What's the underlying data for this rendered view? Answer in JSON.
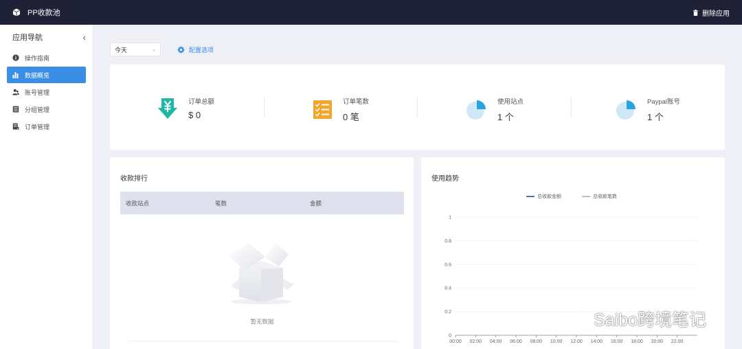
{
  "app": {
    "title": "PP收款池",
    "delete_app": "删除应用"
  },
  "sidebar": {
    "title": "应用导航",
    "collapse": "‹",
    "items": [
      {
        "label": "操作指南",
        "icon": "info-circle-icon"
      },
      {
        "label": "数据概览",
        "icon": "bar-chart-icon",
        "active": true
      },
      {
        "label": "账号管理",
        "icon": "users-icon"
      },
      {
        "label": "分组管理",
        "icon": "list-icon"
      },
      {
        "label": "订单管理",
        "icon": "order-icon"
      }
    ]
  },
  "toolbar": {
    "date_select": "今天",
    "config_link": "配置选项"
  },
  "stats": [
    {
      "label": "订单总额",
      "value": "$ 0",
      "icon": "yuan-download-icon",
      "color": "#1fb8a4"
    },
    {
      "label": "订单笔数",
      "value": "0 笔",
      "icon": "checklist-icon",
      "color": "#f4a52c"
    },
    {
      "label": "使用站点",
      "value": "1 个",
      "icon": "pie-icon",
      "color": "#2aa4dd"
    },
    {
      "label": "Paypal账号",
      "value": "1 个",
      "icon": "pie-icon",
      "color": "#2aa4dd"
    }
  ],
  "ranking": {
    "title": "收款排行",
    "columns": [
      "收款站点",
      "笔数",
      "金额"
    ],
    "empty_text": "暂无数据"
  },
  "trend": {
    "title": "使用趋势"
  },
  "chart_data": {
    "type": "line",
    "series": [
      {
        "name": "总收款金额",
        "color": "#5b6ab8",
        "values": []
      },
      {
        "name": "总收款笔数",
        "color": "#b8bccc",
        "values": []
      }
    ],
    "x_ticks": [
      "00:00",
      "02:00",
      "04:00",
      "06:00",
      "08:00",
      "10:00",
      "12:00",
      "14:00",
      "16:00",
      "18:00",
      "20:00",
      "22:00"
    ],
    "y_ticks": [
      "0",
      "0.2",
      "0.4",
      "0.6",
      "0.8",
      "1"
    ],
    "ylim": [
      0,
      1
    ],
    "grid": true,
    "legend": "top-center"
  },
  "watermark": {
    "text": "Saibo跨境笔记"
  }
}
